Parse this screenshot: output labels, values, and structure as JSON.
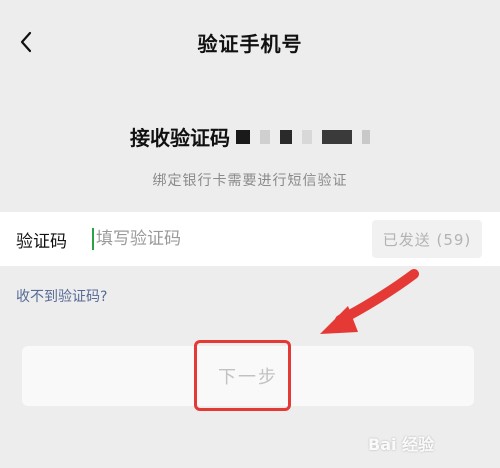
{
  "header": {
    "title": "验证手机号",
    "back_icon": "chevron-left-icon"
  },
  "verify": {
    "receive_title": "接收验证码",
    "subtitle": "绑定银行卡需要进行短信验证"
  },
  "code_field": {
    "label": "验证码",
    "value": "",
    "placeholder": "填写验证码",
    "cursor_color": "#2ba245"
  },
  "resend": {
    "label": "已发送 (59)"
  },
  "no_code_link": "收不到验证码?",
  "next_button": {
    "label": "下一步"
  },
  "annotation": {
    "color": "#e53935"
  },
  "watermark": {
    "text": "Bai 经验"
  }
}
